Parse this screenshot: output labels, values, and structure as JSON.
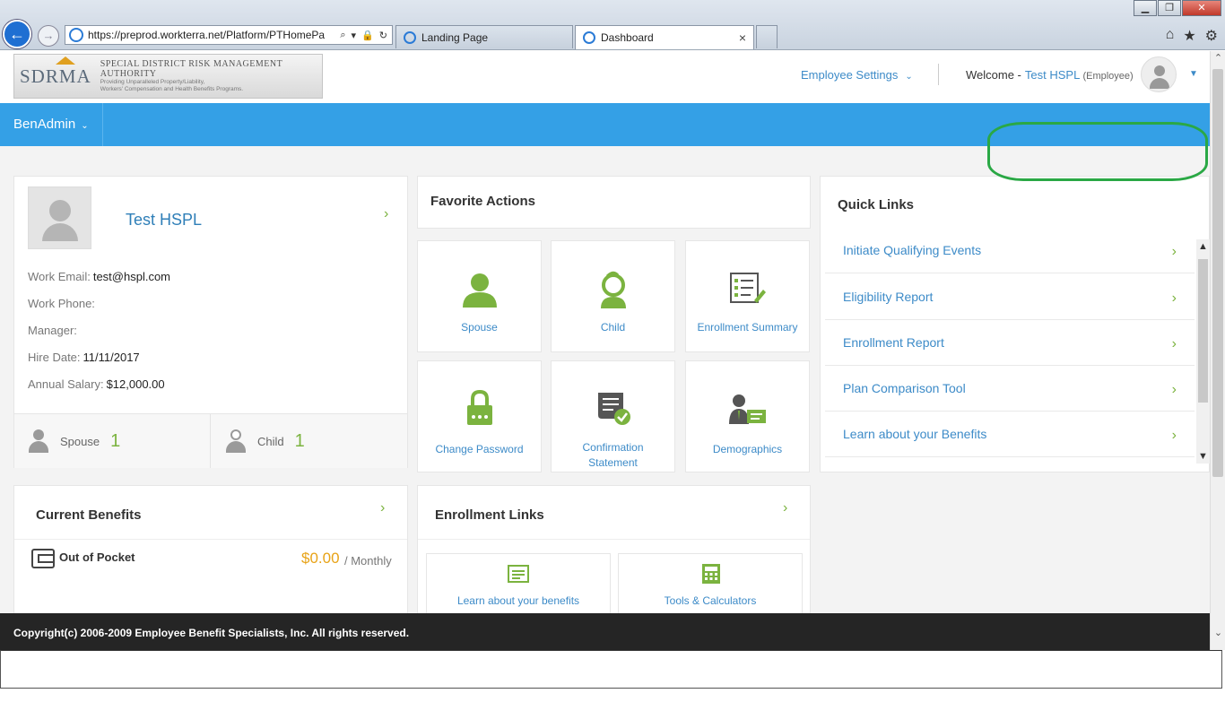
{
  "browser": {
    "url": "https://preprod.workterra.net/Platform/PTHomePa",
    "tabs": [
      {
        "label": "Landing Page"
      },
      {
        "label": "Dashboard"
      }
    ]
  },
  "header": {
    "logo_mark": "SDRMA",
    "logo_title": "Special District Risk Management Authority",
    "logo_sub1": "Providing Unparalleled Property/Liability,",
    "logo_sub2": "Workers' Compensation and Health Benefits Programs.",
    "employee_settings": "Employee Settings",
    "welcome": "Welcome -",
    "user_name": "Test HSPL",
    "user_role": "(Employee)"
  },
  "nav": {
    "benadmin": "BenAdmin"
  },
  "profile": {
    "name": "Test HSPL",
    "work_email_label": "Work Email:",
    "work_email": "test@hspl.com",
    "work_phone_label": "Work Phone:",
    "manager_label": "Manager:",
    "hire_date_label": "Hire Date:",
    "hire_date": "11/11/2017",
    "annual_salary_label": "Annual Salary:",
    "annual_salary": "$12,000.00",
    "spouse_label": "Spouse",
    "spouse_count": "1",
    "child_label": "Child",
    "child_count": "1"
  },
  "favorite_actions": {
    "title": "Favorite Actions",
    "tiles": [
      {
        "label": "Spouse",
        "icon": "person-icon"
      },
      {
        "label": "Child",
        "icon": "child-icon"
      },
      {
        "label": "Enrollment Summary",
        "icon": "summary-icon"
      },
      {
        "label": "Change Password",
        "icon": "lock-icon"
      },
      {
        "label": "Confirmation",
        "label2": "Statement",
        "icon": "certificate-icon"
      },
      {
        "label": "Demographics",
        "icon": "id-card-icon"
      }
    ]
  },
  "quick_links": {
    "title": "Quick Links",
    "items": [
      {
        "label": "Initiate Qualifying Events"
      },
      {
        "label": "Eligibility Report"
      },
      {
        "label": "Enrollment Report"
      },
      {
        "label": "Plan Comparison Tool"
      },
      {
        "label": "Learn about your Benefits"
      }
    ]
  },
  "current_benefits": {
    "title": "Current Benefits",
    "item_label": "Out of Pocket",
    "amount": "$0.00",
    "period": "/ Monthly"
  },
  "enrollment_links": {
    "title": "Enrollment Links",
    "items": [
      {
        "label": "Learn about your benefits"
      },
      {
        "label": "Tools & Calculators"
      }
    ]
  },
  "footer": {
    "copyright": "Copyright(c) 2006-2009 Employee Benefit Specialists, Inc. All rights reserved."
  },
  "colors": {
    "accent_blue": "#34a0e6",
    "link_blue": "#3d8bc8",
    "green": "#7bb33f",
    "amount_orange": "#e8a317",
    "highlight_green": "#2aa845"
  }
}
